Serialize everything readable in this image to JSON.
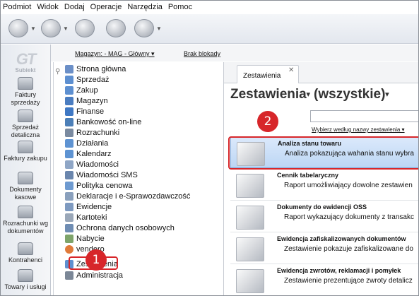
{
  "menu": [
    "Podmiot",
    "Widok",
    "Dodaj",
    "Operacje",
    "Narzędzia",
    "Pomoc"
  ],
  "toolbar_icons": [
    "back-icon",
    "forward-icon",
    "currency-icon",
    "plugin-icon",
    "help-icon"
  ],
  "logo": {
    "mark": "GT",
    "brand": "Subiekt"
  },
  "leftnav": [
    {
      "label": "Faktury sprzedaży",
      "icon": "invoice-icon"
    },
    {
      "label": "Sprzedaż detaliczna",
      "icon": "cart-icon"
    },
    {
      "label": "Faktury zakupu",
      "icon": "purchase-icon"
    },
    {
      "label": "Dokumenty kasowe",
      "icon": "cash-icon"
    },
    {
      "label": "Rozrachunki wg dokumentów",
      "icon": "settlement-icon"
    },
    {
      "label": "Kontrahenci",
      "icon": "contractor-icon"
    },
    {
      "label": "Towary i usługi",
      "icon": "goods-icon"
    }
  ],
  "subheader": {
    "magazyn": "Magazyn: - MAG - Główny ▾",
    "blokady": "Brak blokady"
  },
  "tree": [
    {
      "label": "Strona główna",
      "icon": "home-icon",
      "color": "#6b8fc7"
    },
    {
      "label": "Sprzedaż",
      "icon": "sales-icon",
      "color": "#5d8fd0"
    },
    {
      "label": "Zakup",
      "icon": "purchase-icon",
      "color": "#5d8fd0"
    },
    {
      "label": "Magazyn",
      "icon": "warehouse-icon",
      "color": "#4a7cc0"
    },
    {
      "label": "Finanse",
      "icon": "finance-icon",
      "color": "#3f78c4"
    },
    {
      "label": "Bankowość on-line",
      "icon": "bank-icon",
      "color": "#4c7fb8"
    },
    {
      "label": "Rozrachunki",
      "icon": "settlement-icon",
      "color": "#7a8aa0"
    },
    {
      "label": "Działania",
      "icon": "tasks-icon",
      "color": "#5e93d2"
    },
    {
      "label": "Kalendarz",
      "icon": "calendar-icon",
      "color": "#5e93d2"
    },
    {
      "label": "Wiadomości",
      "icon": "messages-icon",
      "color": "#8fa6c6"
    },
    {
      "label": "Wiadomości SMS",
      "icon": "sms-icon",
      "color": "#6a86ad"
    },
    {
      "label": "Polityka cenowa",
      "icon": "pricing-icon",
      "color": "#6e9ad0"
    },
    {
      "label": "Deklaracje i e-Sprawozdawczość",
      "icon": "declarations-icon",
      "color": "#8aa0bd"
    },
    {
      "label": "Ewidencje",
      "icon": "records-icon",
      "color": "#7e9ac0"
    },
    {
      "label": "Kartoteki",
      "icon": "files-icon",
      "color": "#9aa7b8"
    },
    {
      "label": "Ochrona danych osobowych",
      "icon": "shield-icon",
      "color": "#6f8db3"
    },
    {
      "label": "Nabycie",
      "icon": "acquisition-icon",
      "color": "#7ea46a"
    },
    {
      "label": "vendero",
      "icon": "vendero-icon",
      "color": "#e07a3a"
    },
    {
      "label": "Zestawienia",
      "icon": "reports-icon",
      "color": "#5d8fd0"
    },
    {
      "label": "Administracja",
      "icon": "admin-icon",
      "color": "#7b8797"
    }
  ],
  "content": {
    "tab_label": "Zestawienia",
    "title": "Zestawienia",
    "filter": "(wszystkie)",
    "choose_link": "Wybierz według nazwy zestawienia ▾",
    "entries": [
      {
        "title": "Analiza stanu towaru",
        "desc": "Analiza pokazująca wahania stanu wybra",
        "selected": true
      },
      {
        "title": "Cennik tabelaryczny",
        "desc": "Raport umożliwiający dowolne zestawien",
        "selected": false
      },
      {
        "title": "Dokumenty do ewidencji OSS",
        "desc": "Raport wykazujący dokumenty z transakc",
        "selected": false
      },
      {
        "title": "Ewidencja zafiskalizowanych dokumentów",
        "desc": "Zestawienie pokazuje zafiskalizowane do",
        "selected": false
      },
      {
        "title": "Ewidencja zwrotów, reklamacji i pomyłek",
        "desc": "Zestawienie prezentujące zwroty detalicz",
        "selected": false
      }
    ]
  },
  "badges": [
    "1",
    "2"
  ],
  "colors": {
    "accent_red": "#d7262a",
    "selected_bg": "#bcd6f4"
  }
}
